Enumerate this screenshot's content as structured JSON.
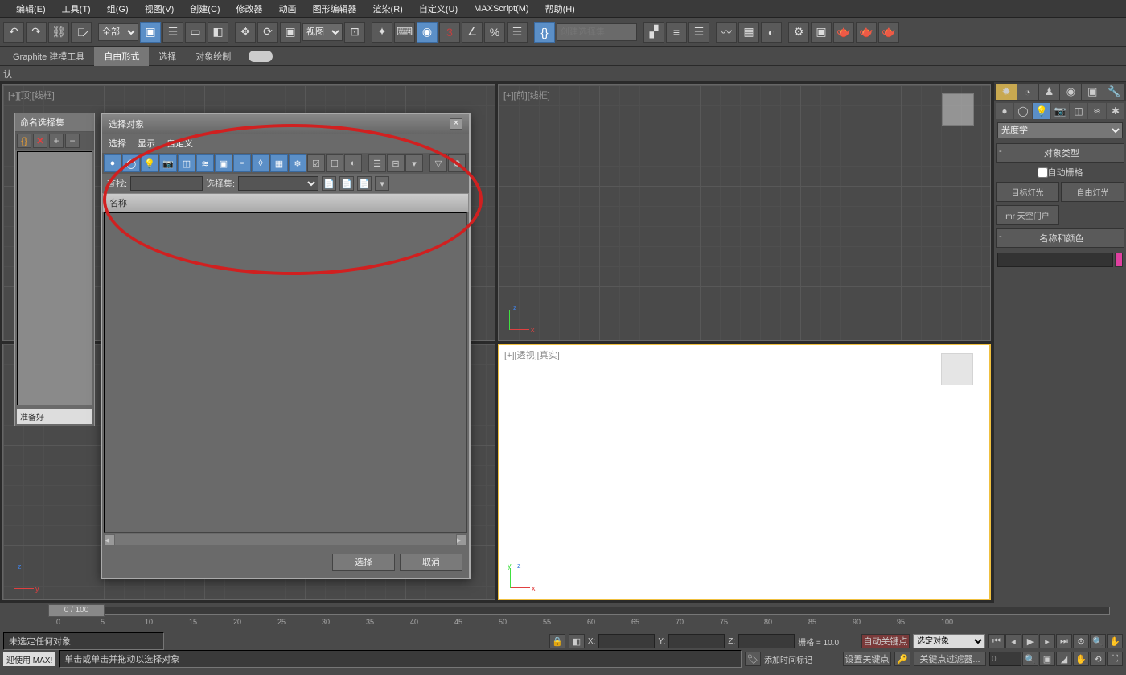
{
  "menubar": [
    "编辑(E)",
    "工具(T)",
    "组(G)",
    "视图(V)",
    "创建(C)",
    "修改器",
    "动画",
    "图形编辑器",
    "渲染(R)",
    "自定义(U)",
    "MAXScript(M)",
    "帮助(H)"
  ],
  "toolbar": {
    "dropdown_all": "全部",
    "dropdown_view": "视图",
    "selset_input": "创建选择集"
  },
  "ribbon": {
    "tab1": "Graphite 建模工具",
    "tab2": "自由形式",
    "tab3": "选择",
    "tab4": "对象绘制"
  },
  "subbar_label": "认",
  "viewports": {
    "top": "[+][顶][线框]",
    "front": "[+][前][线框]",
    "persp": "[+][透视][真实]"
  },
  "named_sel": {
    "title": "命名选择集",
    "status": "准备好"
  },
  "dialog": {
    "title": "选择对象",
    "menu": [
      "选择",
      "显示",
      "自定义"
    ],
    "find_label": "查找:",
    "selset_label": "选择集:",
    "column_header": "名称",
    "btn_select": "选择",
    "btn_cancel": "取消"
  },
  "cmd_panel": {
    "category": "光度学",
    "rollout1": "对象类型",
    "autogrid": "自动栅格",
    "btn1": "目标灯光",
    "btn2": "自由灯光",
    "btn3": "mr 天空门户",
    "rollout2": "名称和颜色"
  },
  "status": {
    "no_select": "未选定任何对象",
    "hint": "单击或单击并拖动以选择对象",
    "grid": "栅格 = 10.0",
    "autokey": "自动关键点",
    "setkey": "设置关键点",
    "sel_dropdown": "选定对象",
    "keyfilter": "关键点过滤器...",
    "addmarker": "添加时间标记",
    "prompt_label": "迎使用 MAX!",
    "slider": "0 / 100",
    "x": "X:",
    "y": "Y:",
    "z": "Z:"
  },
  "ruler_ticks": [
    "0",
    "5",
    "10",
    "15",
    "20",
    "25",
    "30",
    "35",
    "40",
    "45",
    "50",
    "55",
    "60",
    "65",
    "70",
    "75",
    "80",
    "85",
    "90",
    "95",
    "100"
  ]
}
